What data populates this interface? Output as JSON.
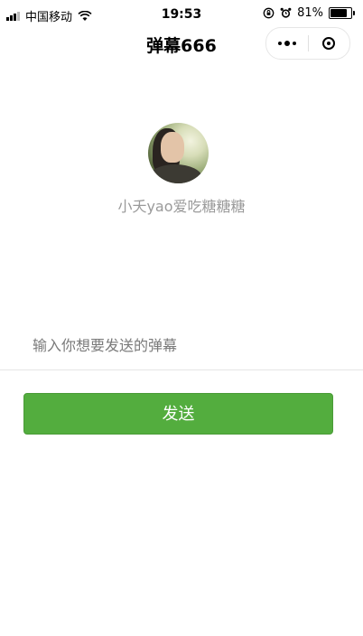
{
  "status_bar": {
    "carrier": "中国移动",
    "time": "19:53",
    "battery_percent": "81%",
    "battery_level": 0.81
  },
  "nav": {
    "title": "弹幕666"
  },
  "profile": {
    "username": "小夭yao爱吃糖糖糖"
  },
  "composer": {
    "placeholder": "输入你想要发送的弹幕",
    "value": "",
    "send_label": "发送"
  },
  "colors": {
    "send_button": "#53ad3e",
    "username_text": "#9a9a9a"
  }
}
